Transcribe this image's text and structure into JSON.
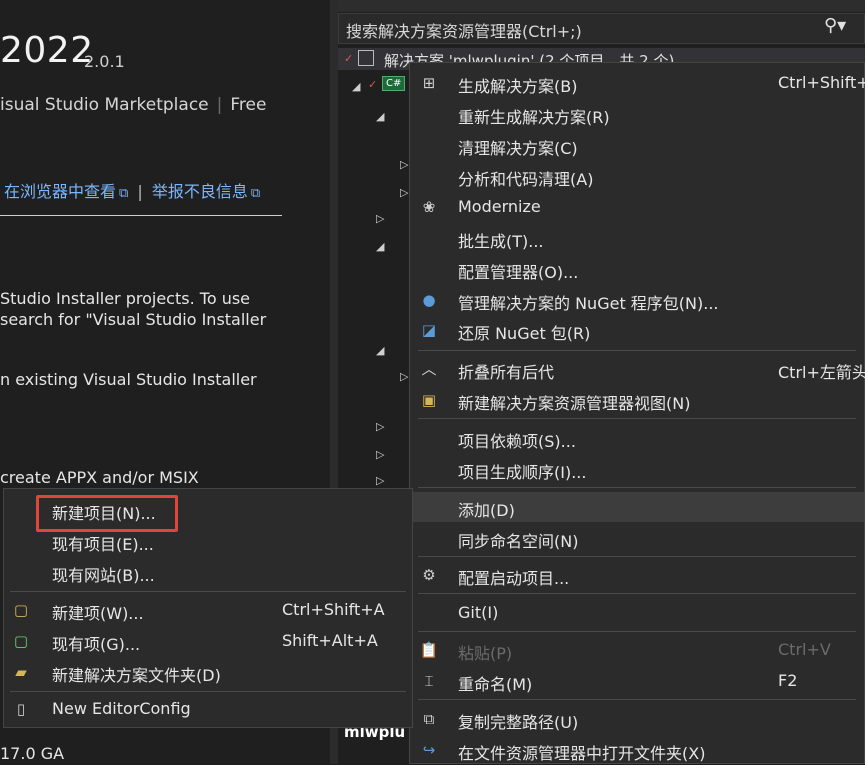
{
  "extension": {
    "title": "2022",
    "version": "2.0.1",
    "publisher": "isual Studio Marketplace",
    "price": "Free",
    "link_view": "在浏览器中查看",
    "link_report": "举报不良信息",
    "desc": [
      "Studio Installer projects. To use",
      "search for \"Visual Studio Installer",
      "n existing Visual Studio Installer",
      "create APPX and/or MSIX"
    ],
    "footer": "17.0 GA"
  },
  "solution_explorer": {
    "search_placeholder": "搜索解决方案资源管理器(Ctrl+;)",
    "root_label": "解决方案 'mlwplugin' (2 个项目，共 2 个)",
    "project_badge": "C#",
    "bottom_label": "mlwplu"
  },
  "main_menu": {
    "items": [
      {
        "label": "生成解决方案(B)",
        "shortcut": "Ctrl+Shift+",
        "icon": "build-solution-icon"
      },
      {
        "label": "重新生成解决方案(R)",
        "shortcut": "",
        "icon": ""
      },
      {
        "label": "清理解决方案(C)",
        "shortcut": "",
        "icon": ""
      },
      {
        "label": "分析和代码清理(A)",
        "shortcut": "",
        "icon": ""
      },
      {
        "label": "Modernize",
        "shortcut": "",
        "icon": "modernize-icon"
      },
      {
        "label": "批生成(T)...",
        "shortcut": "",
        "icon": ""
      },
      {
        "label": "配置管理器(O)...",
        "shortcut": "",
        "icon": ""
      },
      {
        "label": "管理解决方案的 NuGet 程序包(N)...",
        "shortcut": "",
        "icon": "nuget-icon"
      },
      {
        "label": "还原 NuGet 包(R)",
        "shortcut": "",
        "icon": "restore-nuget-icon"
      },
      {
        "label": "折叠所有后代",
        "shortcut": "Ctrl+左箭头",
        "icon": "collapse-icon"
      },
      {
        "label": "新建解决方案资源管理器视图(N)",
        "shortcut": "",
        "icon": "new-view-icon"
      },
      {
        "label": "项目依赖项(S)...",
        "shortcut": "",
        "icon": ""
      },
      {
        "label": "项目生成顺序(I)...",
        "shortcut": "",
        "icon": ""
      },
      {
        "label": "添加(D)",
        "shortcut": "",
        "icon": ""
      },
      {
        "label": "同步命名空间(N)",
        "shortcut": "",
        "icon": ""
      },
      {
        "label": "配置启动项目...",
        "shortcut": "",
        "icon": "gear-icon"
      },
      {
        "label": "Git(I)",
        "shortcut": "",
        "icon": ""
      },
      {
        "label": "粘贴(P)",
        "shortcut": "Ctrl+V",
        "icon": "paste-icon"
      },
      {
        "label": "重命名(M)",
        "shortcut": "F2",
        "icon": "rename-icon"
      },
      {
        "label": "复制完整路径(U)",
        "shortcut": "",
        "icon": "copy-icon"
      },
      {
        "label": "在文件资源管理器中打开文件夹(X)",
        "shortcut": "",
        "icon": "open-folder-icon"
      }
    ]
  },
  "add_menu": {
    "items": [
      {
        "label": "新建项目(N)...",
        "shortcut": ""
      },
      {
        "label": "现有项目(E)...",
        "shortcut": ""
      },
      {
        "label": "现有网站(B)...",
        "shortcut": ""
      },
      {
        "label": "新建项(W)...",
        "shortcut": "Ctrl+Shift+A"
      },
      {
        "label": "现有项(G)...",
        "shortcut": "Shift+Alt+A"
      },
      {
        "label": "新建解决方案文件夹(D)",
        "shortcut": ""
      },
      {
        "label": "New EditorConfig",
        "shortcut": ""
      }
    ]
  }
}
